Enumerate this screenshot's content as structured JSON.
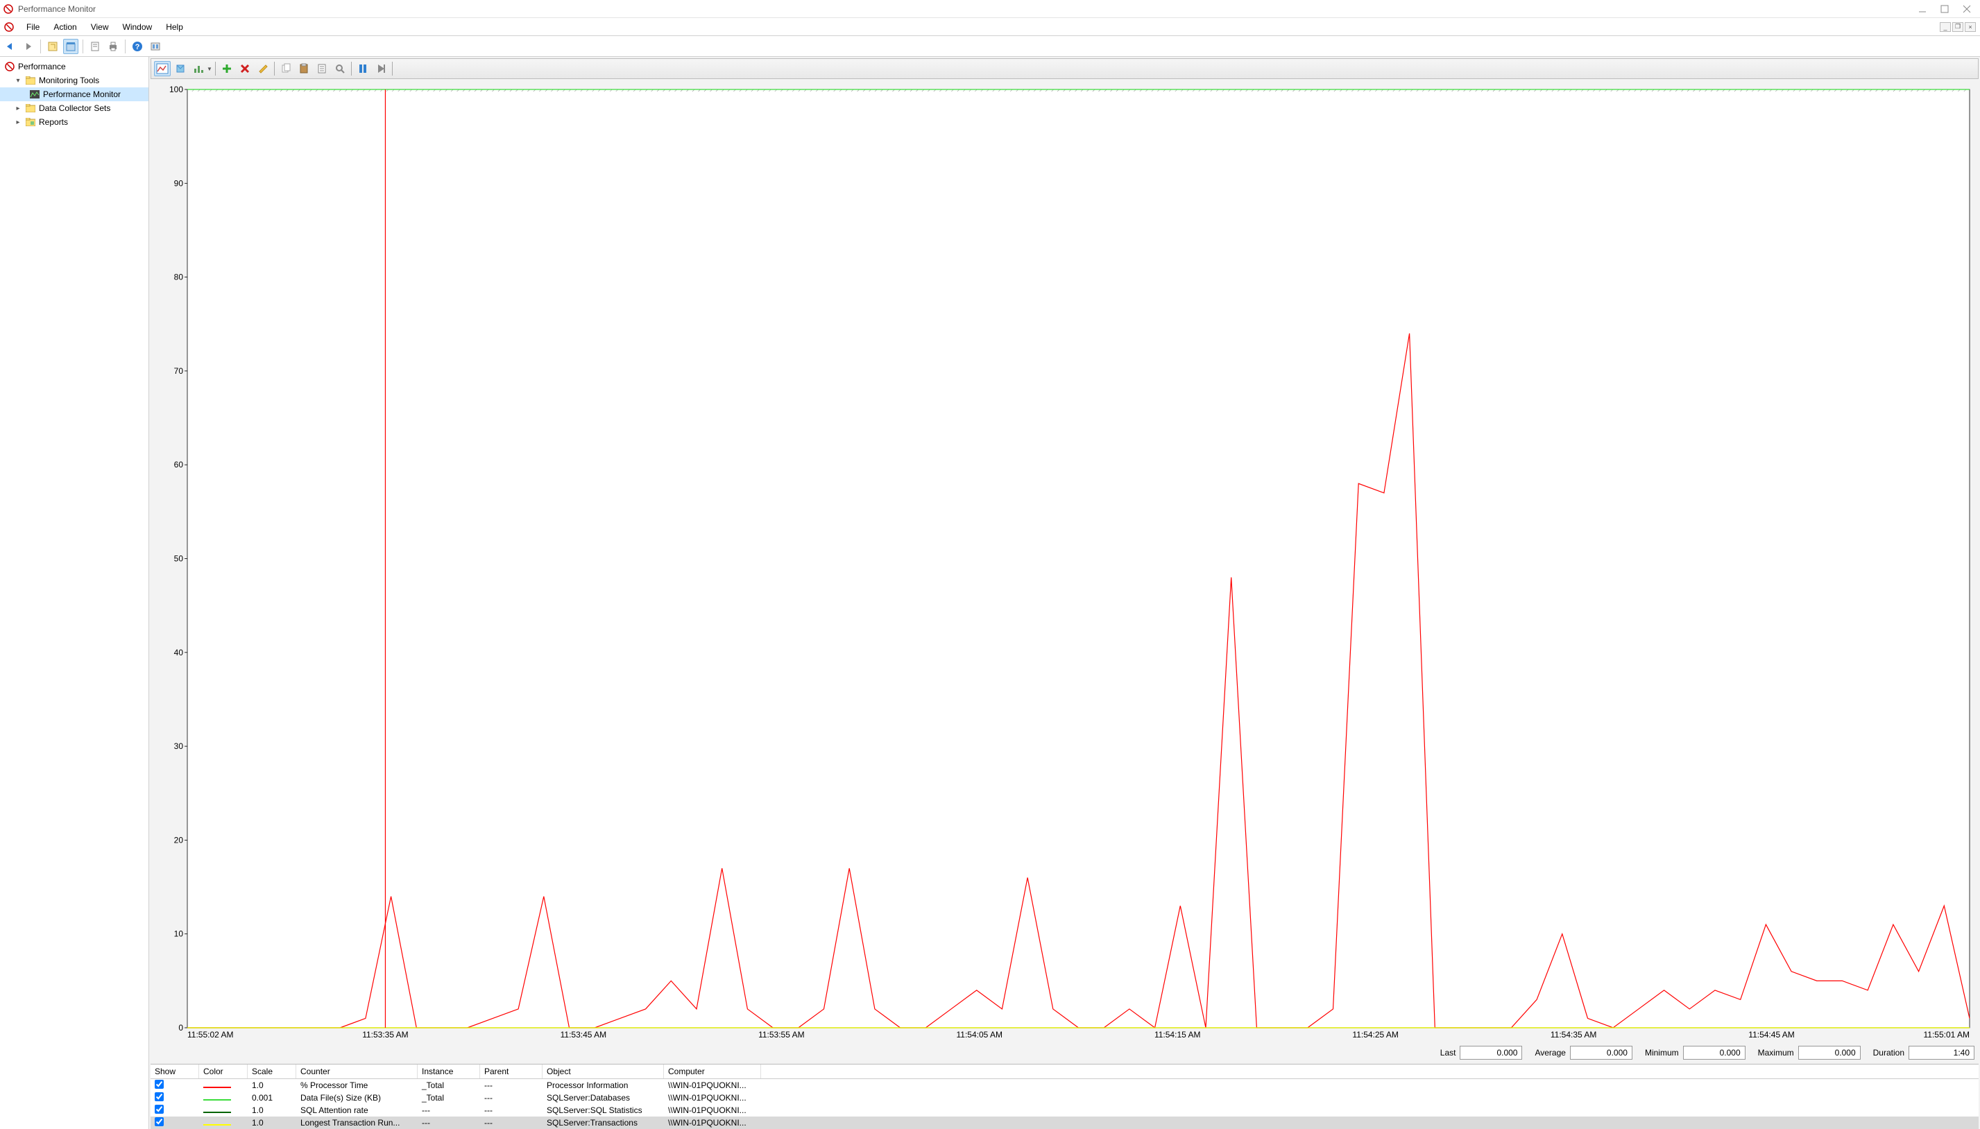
{
  "app_title": "Performance Monitor",
  "menu": {
    "file": "File",
    "action": "Action",
    "view": "View",
    "window": "Window",
    "help": "Help"
  },
  "tree": {
    "root": "Performance",
    "monitoring_tools": "Monitoring Tools",
    "perf_mon": "Performance Monitor",
    "dcs": "Data Collector Sets",
    "reports": "Reports"
  },
  "stats": {
    "last_label": "Last",
    "last_value": "0.000",
    "avg_label": "Average",
    "avg_value": "0.000",
    "min_label": "Minimum",
    "min_value": "0.000",
    "max_label": "Maximum",
    "max_value": "0.000",
    "dur_label": "Duration",
    "dur_value": "1:40"
  },
  "grid": {
    "headers": {
      "show": "Show",
      "color": "Color",
      "scale": "Scale",
      "counter": "Counter",
      "instance": "Instance",
      "parent": "Parent",
      "object": "Object",
      "computer": "Computer"
    },
    "rows": [
      {
        "checked": true,
        "color": "#ff0000",
        "scale": "1.0",
        "counter": "% Processor Time",
        "instance": "_Total",
        "parent": "---",
        "object": "Processor Information",
        "computer": "\\\\WIN-01PQUOKNI..."
      },
      {
        "checked": true,
        "color": "#3cdc3c",
        "scale": "0.001",
        "counter": "Data File(s) Size (KB)",
        "instance": "_Total",
        "parent": "---",
        "object": "SQLServer:Databases",
        "computer": "\\\\WIN-01PQUOKNI..."
      },
      {
        "checked": true,
        "color": "#006400",
        "scale": "1.0",
        "counter": "SQL Attention rate",
        "instance": "---",
        "parent": "---",
        "object": "SQLServer:SQL Statistics",
        "computer": "\\\\WIN-01PQUOKNI..."
      },
      {
        "checked": true,
        "color": "#ffff00",
        "scale": "1.0",
        "counter": "Longest Transaction Run...",
        "instance": "---",
        "parent": "---",
        "object": "SQLServer:Transactions",
        "computer": "\\\\WIN-01PQUOKNI..."
      }
    ]
  },
  "chart_data": {
    "type": "line",
    "ylim": [
      0,
      100
    ],
    "y_ticks": [
      0,
      10,
      20,
      30,
      40,
      50,
      60,
      70,
      80,
      90,
      100
    ],
    "x_ticks": [
      "11:55:02 AM",
      "11:53:35 AM",
      "11:53:45 AM",
      "11:53:55 AM",
      "11:54:05 AM",
      "11:54:15 AM",
      "11:54:25 AM",
      "11:54:35 AM",
      "11:54:45 AM",
      "11:55:01 AM"
    ],
    "cursor_x_index": 1,
    "series": [
      {
        "name": "% Processor Time",
        "color": "#ff0000",
        "x_step": 1,
        "values": [
          0,
          0,
          0,
          0,
          0,
          0,
          0,
          1,
          14,
          0,
          0,
          0,
          1,
          2,
          14,
          0,
          0,
          1,
          2,
          5,
          2,
          17,
          2,
          0,
          0,
          2,
          17,
          2,
          0,
          0,
          2,
          4,
          2,
          16,
          2,
          0,
          0,
          2,
          0,
          13,
          0,
          48,
          0,
          0,
          0,
          2,
          58,
          57,
          74,
          0,
          0,
          0,
          0,
          3,
          10,
          1,
          0,
          2,
          4,
          2,
          4,
          3,
          11,
          6,
          5,
          5,
          4,
          11,
          6,
          13,
          1
        ]
      },
      {
        "name": "Data File(s) Size (KB)",
        "color": "#3cdc3c",
        "x_step": 1,
        "values": [
          100,
          100,
          100,
          100,
          100,
          100,
          100,
          100,
          100,
          100,
          100,
          100,
          100,
          100,
          100,
          100,
          100,
          100,
          100,
          100,
          100,
          100,
          100,
          100,
          100,
          100,
          100,
          100,
          100,
          100,
          100,
          100,
          100,
          100,
          100,
          100,
          100,
          100,
          100,
          100,
          100,
          100,
          100,
          100,
          100,
          100,
          100,
          100,
          100,
          100,
          100,
          100,
          100,
          100,
          100,
          100,
          100,
          100,
          100,
          100,
          100,
          100,
          100,
          100,
          100,
          100,
          100,
          100,
          100,
          100,
          100
        ]
      },
      {
        "name": "SQL Attention rate",
        "color": "#006400",
        "x_step": 1,
        "values": [
          0,
          0,
          0,
          0,
          0,
          0,
          0,
          0,
          0,
          0,
          0,
          0,
          0,
          0,
          0,
          0,
          0,
          0,
          0,
          0,
          0,
          0,
          0,
          0,
          0,
          0,
          0,
          0,
          0,
          0,
          0,
          0,
          0,
          0,
          0,
          0,
          0,
          0,
          0,
          0,
          0,
          0,
          0,
          0,
          0,
          0,
          0,
          0,
          0,
          0,
          0,
          0,
          0,
          0,
          0,
          0,
          0,
          0,
          0,
          0,
          0,
          0,
          0,
          0,
          0,
          0,
          0,
          0,
          0,
          0,
          0
        ]
      },
      {
        "name": "Longest Transaction Running Time",
        "color": "#ffff00",
        "x_step": 1,
        "values": [
          0,
          0,
          0,
          0,
          0,
          0,
          0,
          0,
          0,
          0,
          0,
          0,
          0,
          0,
          0,
          0,
          0,
          0,
          0,
          0,
          0,
          0,
          0,
          0,
          0,
          0,
          0,
          0,
          0,
          0,
          0,
          0,
          0,
          0,
          0,
          0,
          0,
          0,
          0,
          0,
          0,
          0,
          0,
          0,
          0,
          0,
          0,
          0,
          0,
          0,
          0,
          0,
          0,
          0,
          0,
          0,
          0,
          0,
          0,
          0,
          0,
          0,
          0,
          0,
          0,
          0,
          0,
          0,
          0,
          0,
          0
        ]
      }
    ]
  }
}
